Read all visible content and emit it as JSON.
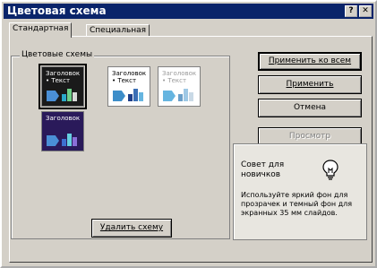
{
  "window": {
    "title": "Цветовая схема",
    "help_glyph": "?",
    "close_glyph": "✕"
  },
  "tabs": [
    {
      "label": "Стандартная",
      "active": true
    },
    {
      "label": "Специальная",
      "active": false
    }
  ],
  "schemes_group": {
    "label": "Цветовые схемы",
    "swatches": [
      {
        "title": "Заголовок",
        "text": "• Текст",
        "bg": "#1a1a1a",
        "fg": "#ffffff",
        "shape": "#4a8fd6",
        "bars": [
          "#2aa8c9",
          "#6fcf88",
          "#d8d8d8"
        ],
        "selected": true
      },
      {
        "title": "Заголовок",
        "text": "• Текст",
        "bg": "#ffffff",
        "fg": "#000000",
        "shape": "#3d8ec9",
        "bars": [
          "#1e3f8a",
          "#3b6fb5",
          "#66b5e0"
        ],
        "selected": false
      },
      {
        "title": "Заголовок",
        "text": "• Текст",
        "bg": "#ffffff",
        "fg": "#9a9a9a",
        "shape": "#66b5e0",
        "bars": [
          "#6a9fc9",
          "#9ec8e5",
          "#c9d9e6"
        ],
        "selected": false
      },
      {
        "title": "Заголовок",
        "text": "",
        "bg": "#2a1a5a",
        "fg": "#ffffff",
        "shape": "#4a8fd6",
        "bars": [
          "#3d6fd0",
          "#66cfe0",
          "#8a6fd8"
        ],
        "selected": false
      }
    ]
  },
  "buttons": {
    "apply_all": "Применить ко всем",
    "apply": "Применить",
    "cancel": "Отмена",
    "preview": "Просмотр",
    "delete_scheme": "Удалить схему"
  },
  "tip": {
    "title": "Совет для новичков",
    "text": "Используйте яркий фон для прозрачек и темный фон для экранных 35 мм слайдов.",
    "icon": "lightbulb-icon"
  },
  "colors": {
    "titlebar": "#0a246a",
    "face": "#d4d0c8"
  }
}
